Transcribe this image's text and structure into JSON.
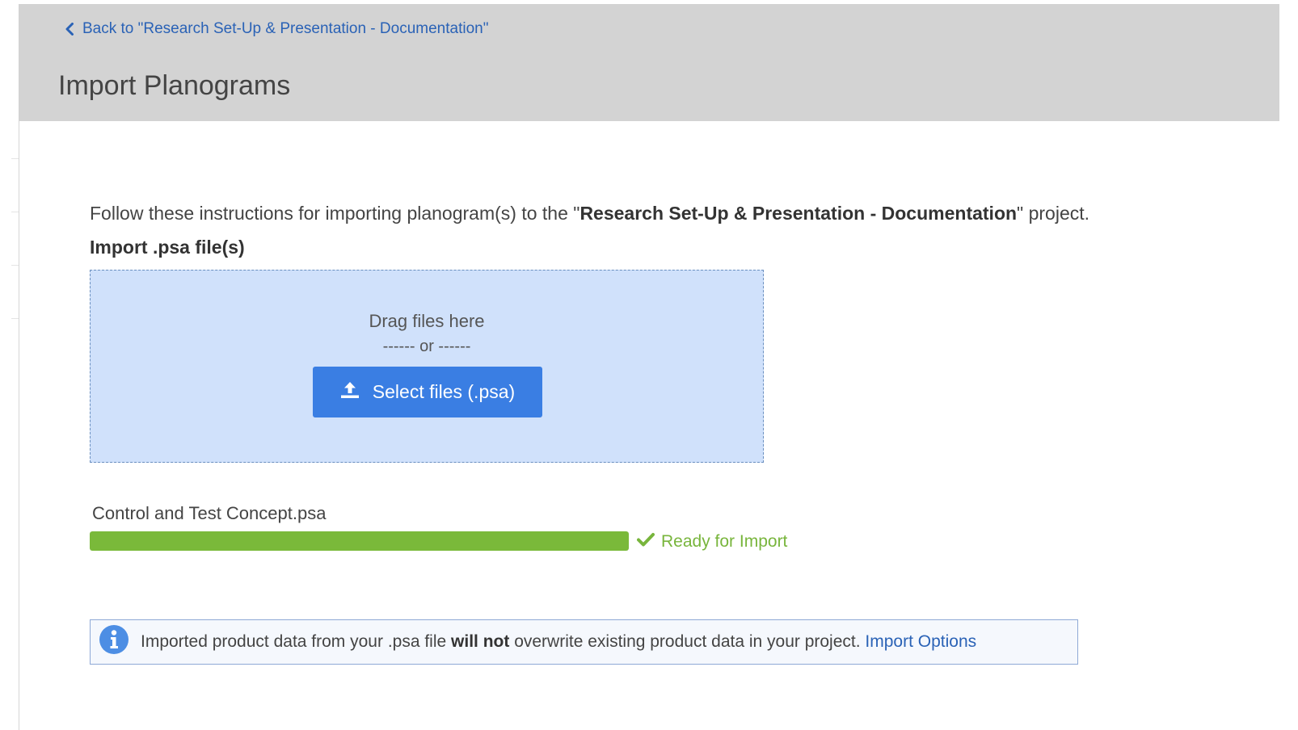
{
  "header": {
    "back_link": "Back to \"Research Set-Up & Presentation - Documentation\"",
    "title": "Import Planograms"
  },
  "instructions": {
    "prefix": "Follow these instructions for importing planogram(s) to the \"",
    "project_name": "Research Set-Up & Presentation - Documentation",
    "suffix": "\" project."
  },
  "upload": {
    "section_label": "Import .psa file(s)",
    "drag_text": "Drag files here",
    "or_text": "------ or ------",
    "select_button_label": "Select files (.psa)"
  },
  "file": {
    "name": "Control and Test Concept.psa",
    "progress_percent": 100,
    "status": "Ready for Import"
  },
  "notice": {
    "text_before": "Imported product data from your .psa file ",
    "text_bold": "will not",
    "text_after": " overwrite existing product data in your project. ",
    "link_label": "Import Options"
  },
  "colors": {
    "header_bg": "#d3d3d3",
    "link": "#2a62b6",
    "dropzone_bg": "#d0e1fb",
    "button_bg": "#3a7ee3",
    "progress": "#7ab93a",
    "status_green": "#78b53c",
    "info_icon": "#4d8ee4"
  },
  "icons": {
    "back": "chevron-left-icon",
    "upload": "upload-icon",
    "status": "check-icon",
    "info": "info-circle-icon"
  }
}
